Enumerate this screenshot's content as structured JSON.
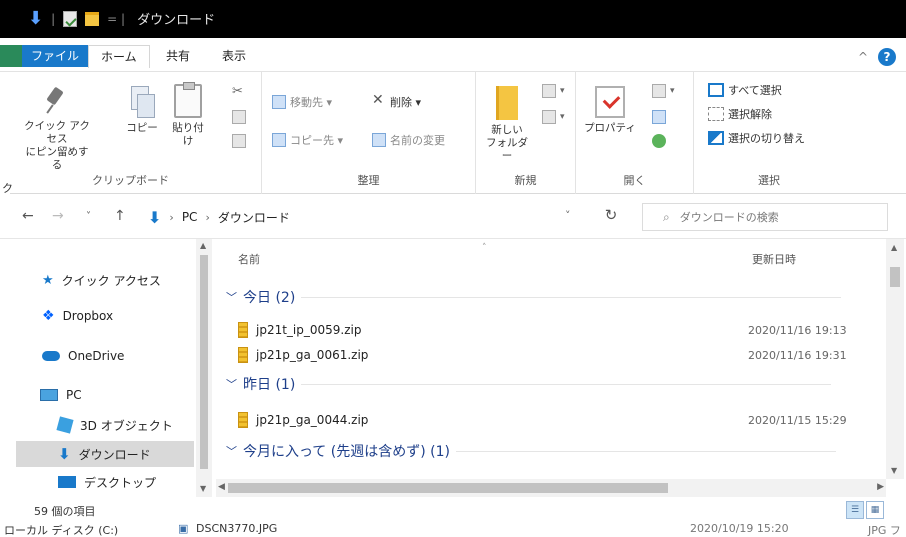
{
  "window": {
    "title": "ダウンロード"
  },
  "ribbon_tabs": {
    "file": "ファイル",
    "home": "ホーム",
    "share": "共有",
    "view": "表示"
  },
  "ribbon": {
    "clipboard": {
      "pin_label_1": "クイック アクセス",
      "pin_label_2": "にピン留めする",
      "copy": "コピー",
      "paste": "貼り付け",
      "group": "クリップボード"
    },
    "organize": {
      "move_to": "移動先 ▾",
      "delete": "削除 ▾",
      "copy_to": "コピー先 ▾",
      "rename": "名前の変更",
      "group": "整理"
    },
    "new": {
      "new_folder_1": "新しい",
      "new_folder_2": "フォルダー",
      "group": "新規"
    },
    "open": {
      "properties": "プロパティ",
      "group": "開く"
    },
    "select": {
      "select_all": "すべて選択",
      "select_none": "選択解除",
      "invert": "選択の切り替え",
      "group": "選択"
    }
  },
  "address": {
    "crumbs": [
      "PC",
      "ダウンロード"
    ],
    "search_placeholder": "ダウンロードの検索"
  },
  "navpane": {
    "items": [
      {
        "label": "クイック アクセス",
        "icon": "star-icon"
      },
      {
        "label": "Dropbox",
        "icon": "dropbox-icon"
      },
      {
        "label": "OneDrive",
        "icon": "cloud-icon"
      },
      {
        "label": "PC",
        "icon": "pc-icon"
      },
      {
        "label": "3D オブジェクト",
        "icon": "cube-icon"
      },
      {
        "label": "ダウンロード",
        "icon": "download-icon"
      },
      {
        "label": "デスクトップ",
        "icon": "desktop-icon"
      }
    ]
  },
  "filelist": {
    "col_name": "名前",
    "col_date": "更新日時",
    "groups": [
      {
        "label": "今日 (2)",
        "files": [
          {
            "name": "jp21t_ip_0059.zip",
            "date": "2020/11/16 19:13"
          },
          {
            "name": "jp21p_ga_0061.zip",
            "date": "2020/11/16 19:31"
          }
        ]
      },
      {
        "label": "昨日 (1)",
        "files": [
          {
            "name": "jp21p_ga_0044.zip",
            "date": "2020/11/15 15:29"
          }
        ]
      },
      {
        "label": "今月に入って (先週は含めず) (1)",
        "files": []
      }
    ]
  },
  "status": {
    "count": "59 個の項目"
  },
  "background_row": {
    "left": "ローカル ディスク (C:)",
    "file": "DSCN3770.JPG",
    "date": "2020/10/19 15:20",
    "type": "JPG フ"
  }
}
